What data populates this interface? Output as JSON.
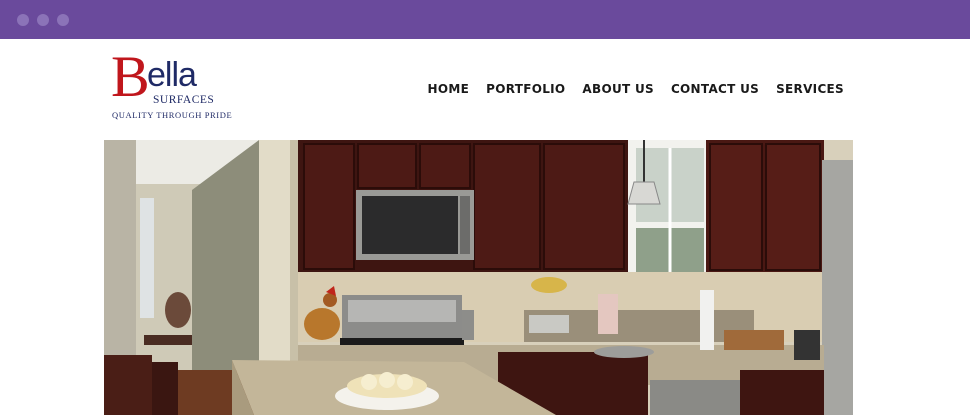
{
  "window": {
    "controls": [
      "close-dot",
      "minimize-dot",
      "maximize-dot"
    ],
    "accent_color": "#6a4a9c"
  },
  "logo": {
    "initial": "B",
    "rest": "ella",
    "sub": "SURFACES",
    "tagline": "QUALITY THROUGH PRIDE",
    "colors": {
      "initial": "#c0161c",
      "text": "#1f2a66"
    }
  },
  "nav": {
    "items": [
      {
        "label": "HOME"
      },
      {
        "label": "PORTFOLIO"
      },
      {
        "label": "ABOUT US"
      },
      {
        "label": "CONTACT US"
      },
      {
        "label": "SERVICES"
      }
    ]
  },
  "hero": {
    "icon": "kitchen-photo"
  }
}
